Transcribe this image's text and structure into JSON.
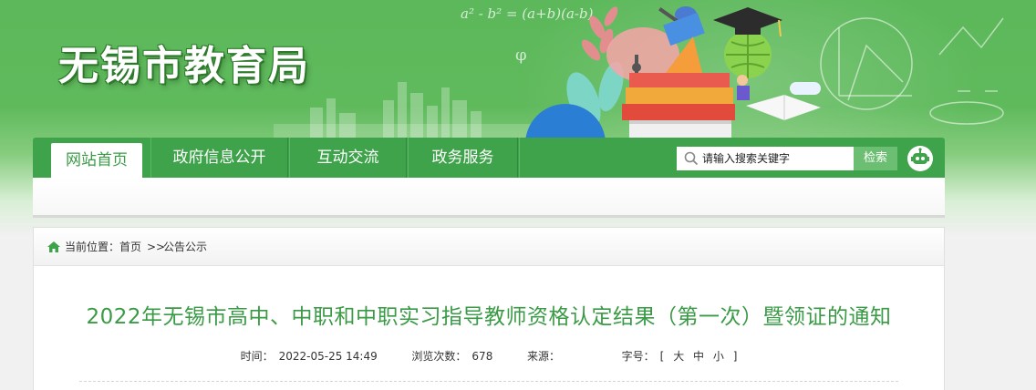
{
  "header": {
    "site_title": "无锡市教育局",
    "formula": "a² - b² = (a+b)(a-b)",
    "phi": "φ"
  },
  "nav": {
    "items": [
      {
        "label": "网站首页"
      },
      {
        "label": "政府信息公开"
      },
      {
        "label": "互动交流"
      },
      {
        "label": "政务服务"
      }
    ],
    "search_placeholder": "请输入搜索关键字",
    "search_button": "检索"
  },
  "breadcrumb": {
    "label": "当前位置：",
    "home": "首页",
    "separator": ">>",
    "current": "公告公示"
  },
  "article": {
    "title": "2022年无锡市高中、中职和中职实习指导教师资格认定结果（第一次）暨领证的通知",
    "time_label": "时间：",
    "time_value": "2022-05-25 14:49",
    "views_label": "浏览次数：",
    "views_value": "678",
    "source_label": "来源：",
    "source_value": "",
    "fontsize_label": "字号：",
    "fontsize_open": "[",
    "fontsize_large": "大",
    "fontsize_medium": "中",
    "fontsize_small": "小",
    "fontsize_close": "]"
  },
  "colors": {
    "brand_green": "#3ea34a",
    "title_green": "#3a9a45",
    "banner_green": "#5cb85a"
  }
}
